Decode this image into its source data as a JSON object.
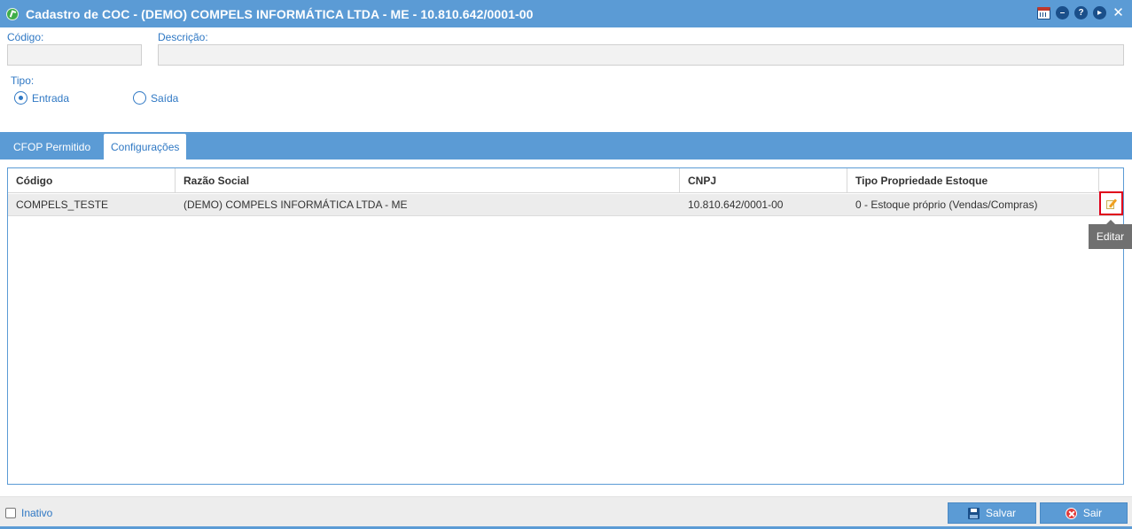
{
  "window": {
    "title": "Cadastro de COC - (DEMO) COMPELS INFORMÁTICA LTDA - ME - 10.810.642/0001-00",
    "title_icon": "green-refresh-icon",
    "title_buttons": [
      "calendar-icon",
      "minimize-icon",
      "help-icon",
      "play-icon",
      "close-icon"
    ],
    "accent_color": "#5b9bd5"
  },
  "form": {
    "codigo_label": "Código:",
    "codigo_value": "",
    "descricao_label": "Descrição:",
    "descricao_value": "",
    "tipo_label": "Tipo:",
    "tipo_options": [
      {
        "label": "Entrada",
        "checked": true
      },
      {
        "label": "Saída",
        "checked": false
      }
    ]
  },
  "tabs": [
    {
      "label": "CFOP Permitido",
      "active": false
    },
    {
      "label": "Configurações",
      "active": true
    }
  ],
  "grid": {
    "columns": [
      "Código",
      "Razão Social",
      "CNPJ",
      "Tipo Propriedade Estoque"
    ],
    "rows": [
      {
        "codigo": "COMPELS_TESTE",
        "razao_social": "(DEMO) COMPELS INFORMÁTICA LTDA - ME",
        "cnpj": "10.810.642/0001-00",
        "tipo_propriedade_estoque": "0 - Estoque próprio (Vendas/Compras)"
      }
    ],
    "row_action_icon": "pencil-edit-icon",
    "tooltip": "Editar"
  },
  "footer": {
    "inativo_label": "Inativo",
    "inativo_checked": false,
    "save_label": "Salvar",
    "exit_label": "Sair"
  }
}
